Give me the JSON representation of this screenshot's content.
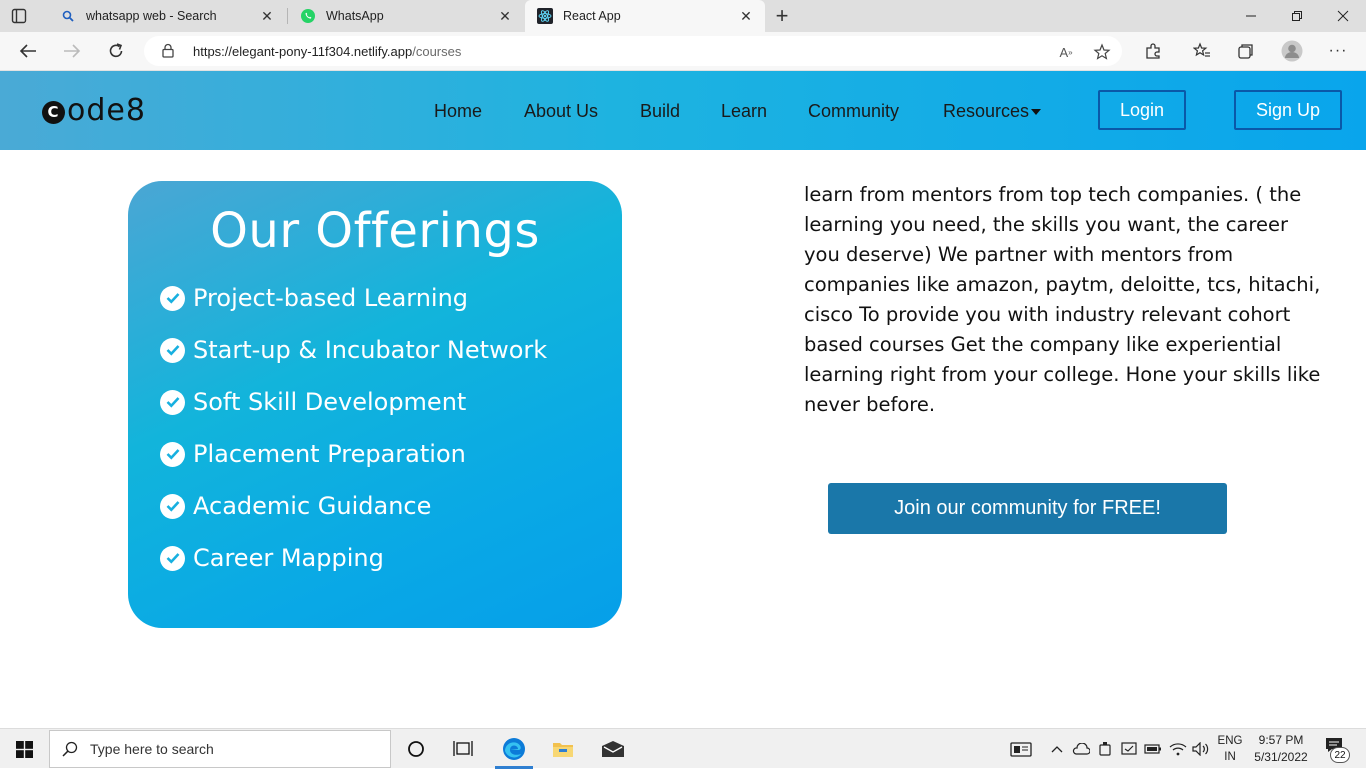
{
  "browser": {
    "tabs": [
      {
        "title": "whatsapp web - Search",
        "favicon": "search-icon"
      },
      {
        "title": "WhatsApp",
        "favicon": "whatsapp-icon"
      },
      {
        "title": "React App",
        "favicon": "react-icon"
      }
    ],
    "active_tab": 2,
    "url_host": "https://elegant-pony-11f304.netlify.app",
    "url_path": "/courses",
    "colors": {
      "tabstrip": "#dfdfdf",
      "toolbar": "#f7f7f7"
    }
  },
  "site": {
    "logo_letter": "C",
    "logo_rest": "ode8",
    "nav": {
      "home": "Home",
      "about": "About Us",
      "build": "Build",
      "learn": "Learn",
      "community": "Community",
      "resources": "Resources"
    },
    "login_label": "Login",
    "signup_label": "Sign Up",
    "colors": {
      "nav_gradient_start": "#4aaad6",
      "nav_gradient_end": "#09a5ec",
      "button_border": "#0a58a8"
    }
  },
  "offerings": {
    "title": "Our Offerings",
    "items": [
      "Project-based Learning",
      "Start-up & Incubator Network",
      "Soft Skill Development",
      "Placement Preparation",
      "Academic Guidance",
      "Career Mapping"
    ]
  },
  "about": {
    "text": "learn from mentors from top tech companies. ( the learning you need, the skills you want, the career you deserve) We partner with mentors from companies like amazon, paytm, deloitte, tcs, hitachi, cisco To provide you with industry relevant cohort based courses Get the company like experiential learning right from your college. Hone your skills like never before.",
    "join_label": "Join our community for FREE!",
    "join_color": "#1a77a9"
  },
  "taskbar": {
    "search_placeholder": "Type here to search",
    "lang_top": "ENG",
    "lang_bottom": "IN",
    "time": "9:57 PM",
    "date": "5/31/2022",
    "notification_count": "22"
  }
}
